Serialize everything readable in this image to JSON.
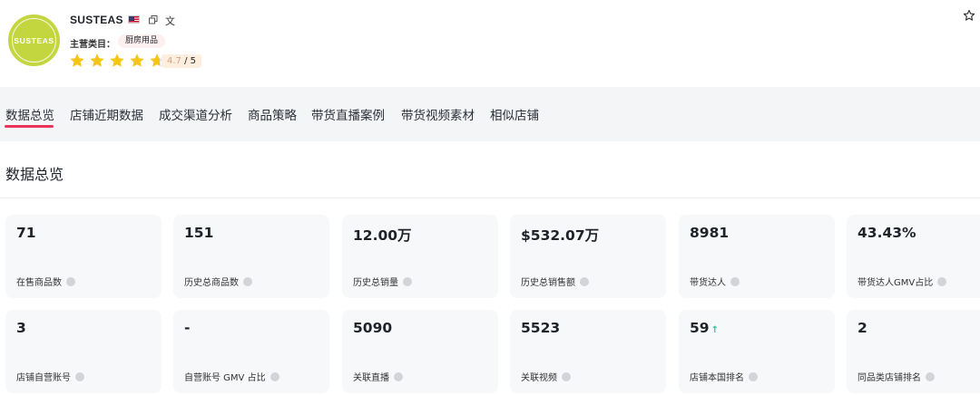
{
  "shop": {
    "logo_text": "SUSTEAS",
    "name": "SUSTEAS",
    "category_label": "主营类目：",
    "category": "厨房用品",
    "rating_value": "4.7",
    "rating_max": "/ 5",
    "stars": 4.7,
    "star_color": "#f5c518"
  },
  "tabs": [
    {
      "label": "数据总览",
      "active": true
    },
    {
      "label": "店铺近期数据"
    },
    {
      "label": "成交渠道分析"
    },
    {
      "label": "商品策略"
    },
    {
      "label": "带货直播案例"
    },
    {
      "label": "带货视频素材"
    },
    {
      "label": "相似店铺"
    }
  ],
  "section_title": "数据总览",
  "cards": [
    {
      "value": "71",
      "label": "在售商品数"
    },
    {
      "value": "151",
      "label": "历史总商品数"
    },
    {
      "value": "12.00万",
      "label": "历史总销量"
    },
    {
      "value": "$532.07万",
      "label": "历史总销售额"
    },
    {
      "value": "8981",
      "label": "带货达人"
    },
    {
      "value": "43.43%",
      "label": "带货达人GMV占比"
    },
    {
      "value": "3",
      "label": "店铺自营账号"
    },
    {
      "value": "-",
      "label": "自营账号 GMV 占比"
    },
    {
      "value": "5090",
      "label": "关联直播"
    },
    {
      "value": "5523",
      "label": "关联视频"
    },
    {
      "value": "59",
      "label": "店铺本国排名",
      "arrow": "↑"
    },
    {
      "value": "2",
      "label": "同品类店铺排名"
    }
  ],
  "icons": {
    "flag": "us-flag-icon",
    "copy": "copy-icon",
    "translate": "translate-icon",
    "favorite": "star-outline-icon",
    "info": "info-icon"
  },
  "colors": {
    "accent": "#e8345a",
    "logo": "#c3d63f",
    "card_bg": "#f7f8fa",
    "up_arrow": "#2ec4a0"
  }
}
